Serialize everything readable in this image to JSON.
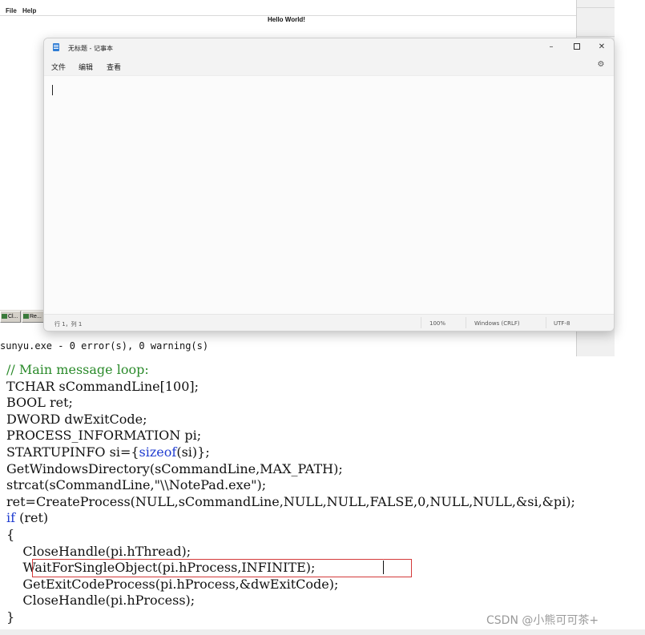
{
  "background_app": {
    "menu": [
      "File",
      "Help"
    ],
    "content_text": "Hello World!"
  },
  "taskbar": {
    "buttons": [
      "Cl...",
      "Re..."
    ]
  },
  "build_output": "sunyu.exe - 0 error(s), 0 warning(s)",
  "notepad": {
    "title": "无标题 - 记事本",
    "window_controls": {
      "minimize": "–",
      "maximize": "",
      "close": "✕"
    },
    "menu": [
      "文件",
      "编辑",
      "查看"
    ],
    "settings_icon": "gear-icon",
    "editor_text": "",
    "status": {
      "position": "行 1，列 1",
      "zoom": "100%",
      "line_endings": "Windows (CRLF)",
      "encoding": "UTF-8"
    }
  },
  "code": {
    "lines": [
      [
        {
          "t": "// Main message loop:",
          "c": "cm"
        }
      ],
      [
        {
          "t": "TCHAR sCommandLine[100];"
        }
      ],
      [
        {
          "t": "BOOL ret;"
        }
      ],
      [
        {
          "t": "DWORD dwExitCode;"
        }
      ],
      [
        {
          "t": "PROCESS_INFORMATION pi;"
        }
      ],
      [
        {
          "t": "STARTUPINFO si={"
        },
        {
          "t": "sizeof",
          "c": "kw"
        },
        {
          "t": "(si)};"
        }
      ],
      [
        {
          "t": "GetWindowsDirectory(sCommandLine,MAX_PATH);"
        }
      ],
      [
        {
          "t": "strcat(sCommandLine,\"\\\\NotePad.exe\");"
        }
      ],
      [
        {
          "t": "ret=CreateProcess(NULL,sCommandLine,NULL,NULL,FALSE,0,NULL,NULL,&si,&pi);"
        }
      ],
      [
        {
          "t": "if",
          "c": "kw"
        },
        {
          "t": " (ret)"
        }
      ],
      [
        {
          "t": "{"
        }
      ],
      [
        {
          "t": "    CloseHandle(pi.hThread);"
        }
      ],
      [
        {
          "t": "    WaitForSingleObject(pi.hProcess,INFINITE);"
        }
      ],
      [
        {
          "t": "    GetExitCodeProcess(pi.hProcess,&dwExitCode);"
        }
      ],
      [
        {
          "t": "    CloseHandle(pi.hProcess);"
        }
      ],
      [
        {
          "t": "}"
        }
      ]
    ],
    "highlighted_line": 12
  },
  "watermark": "CSDN @小熊可可茶+",
  "colors": {
    "keyword": "#1f3cd0",
    "comment": "#2a8a2a",
    "highlight_border": "#d43a3a"
  }
}
